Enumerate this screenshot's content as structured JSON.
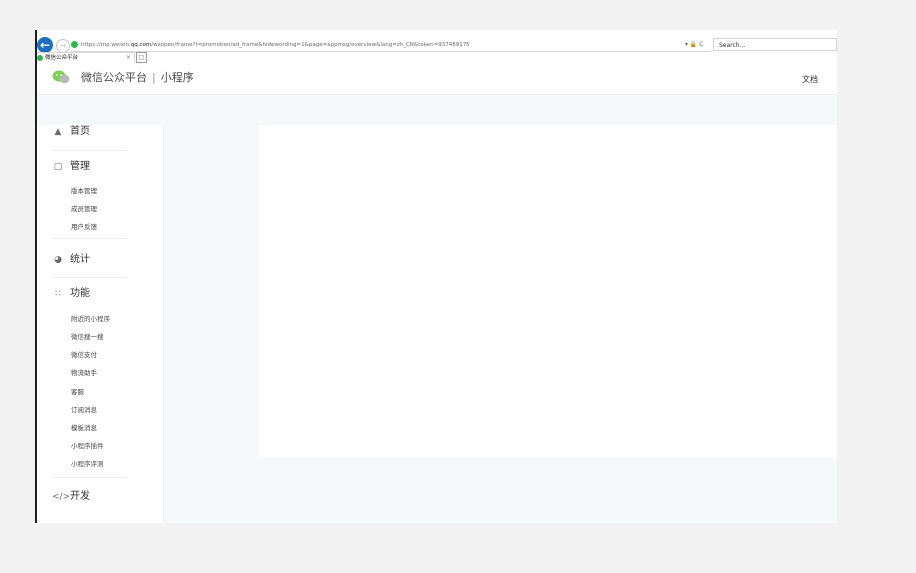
{
  "browser": {
    "url_prefix": "https://mp.weixin.",
    "url_host": "qq.com",
    "url_rest": "/wxopen/frame?t=promotion/ad_frame&hidewording=1&page=appmsg/overview&lang=zh_CN&token=937489175",
    "url_icons": "▾ 🔒 C",
    "search_placeholder": "Search...",
    "tab_title": "微信公众平台",
    "tab_close": "×",
    "back_icon": "arrow-left-icon",
    "forward_icon": "arrow-right-icon"
  },
  "header": {
    "platform_name": "微信公众平台",
    "separator": "|",
    "product_name": "小程序",
    "docs_link": "文档"
  },
  "sidebar": {
    "home": "首页",
    "manage": {
      "label": "管理",
      "items": [
        "版本管理",
        "成员管理",
        "用户反馈"
      ]
    },
    "stats": "统计",
    "features": {
      "label": "功能",
      "items": [
        "附近的小程序",
        "微信搜一搜",
        "微信支付",
        "物流助手",
        "客服",
        "订阅消息",
        "模板消息",
        "小程序插件",
        "小程序评测"
      ]
    },
    "develop": "开发"
  },
  "colors": {
    "brand_green": "#2db84c",
    "back_button_blue": "#1b6ec2"
  }
}
